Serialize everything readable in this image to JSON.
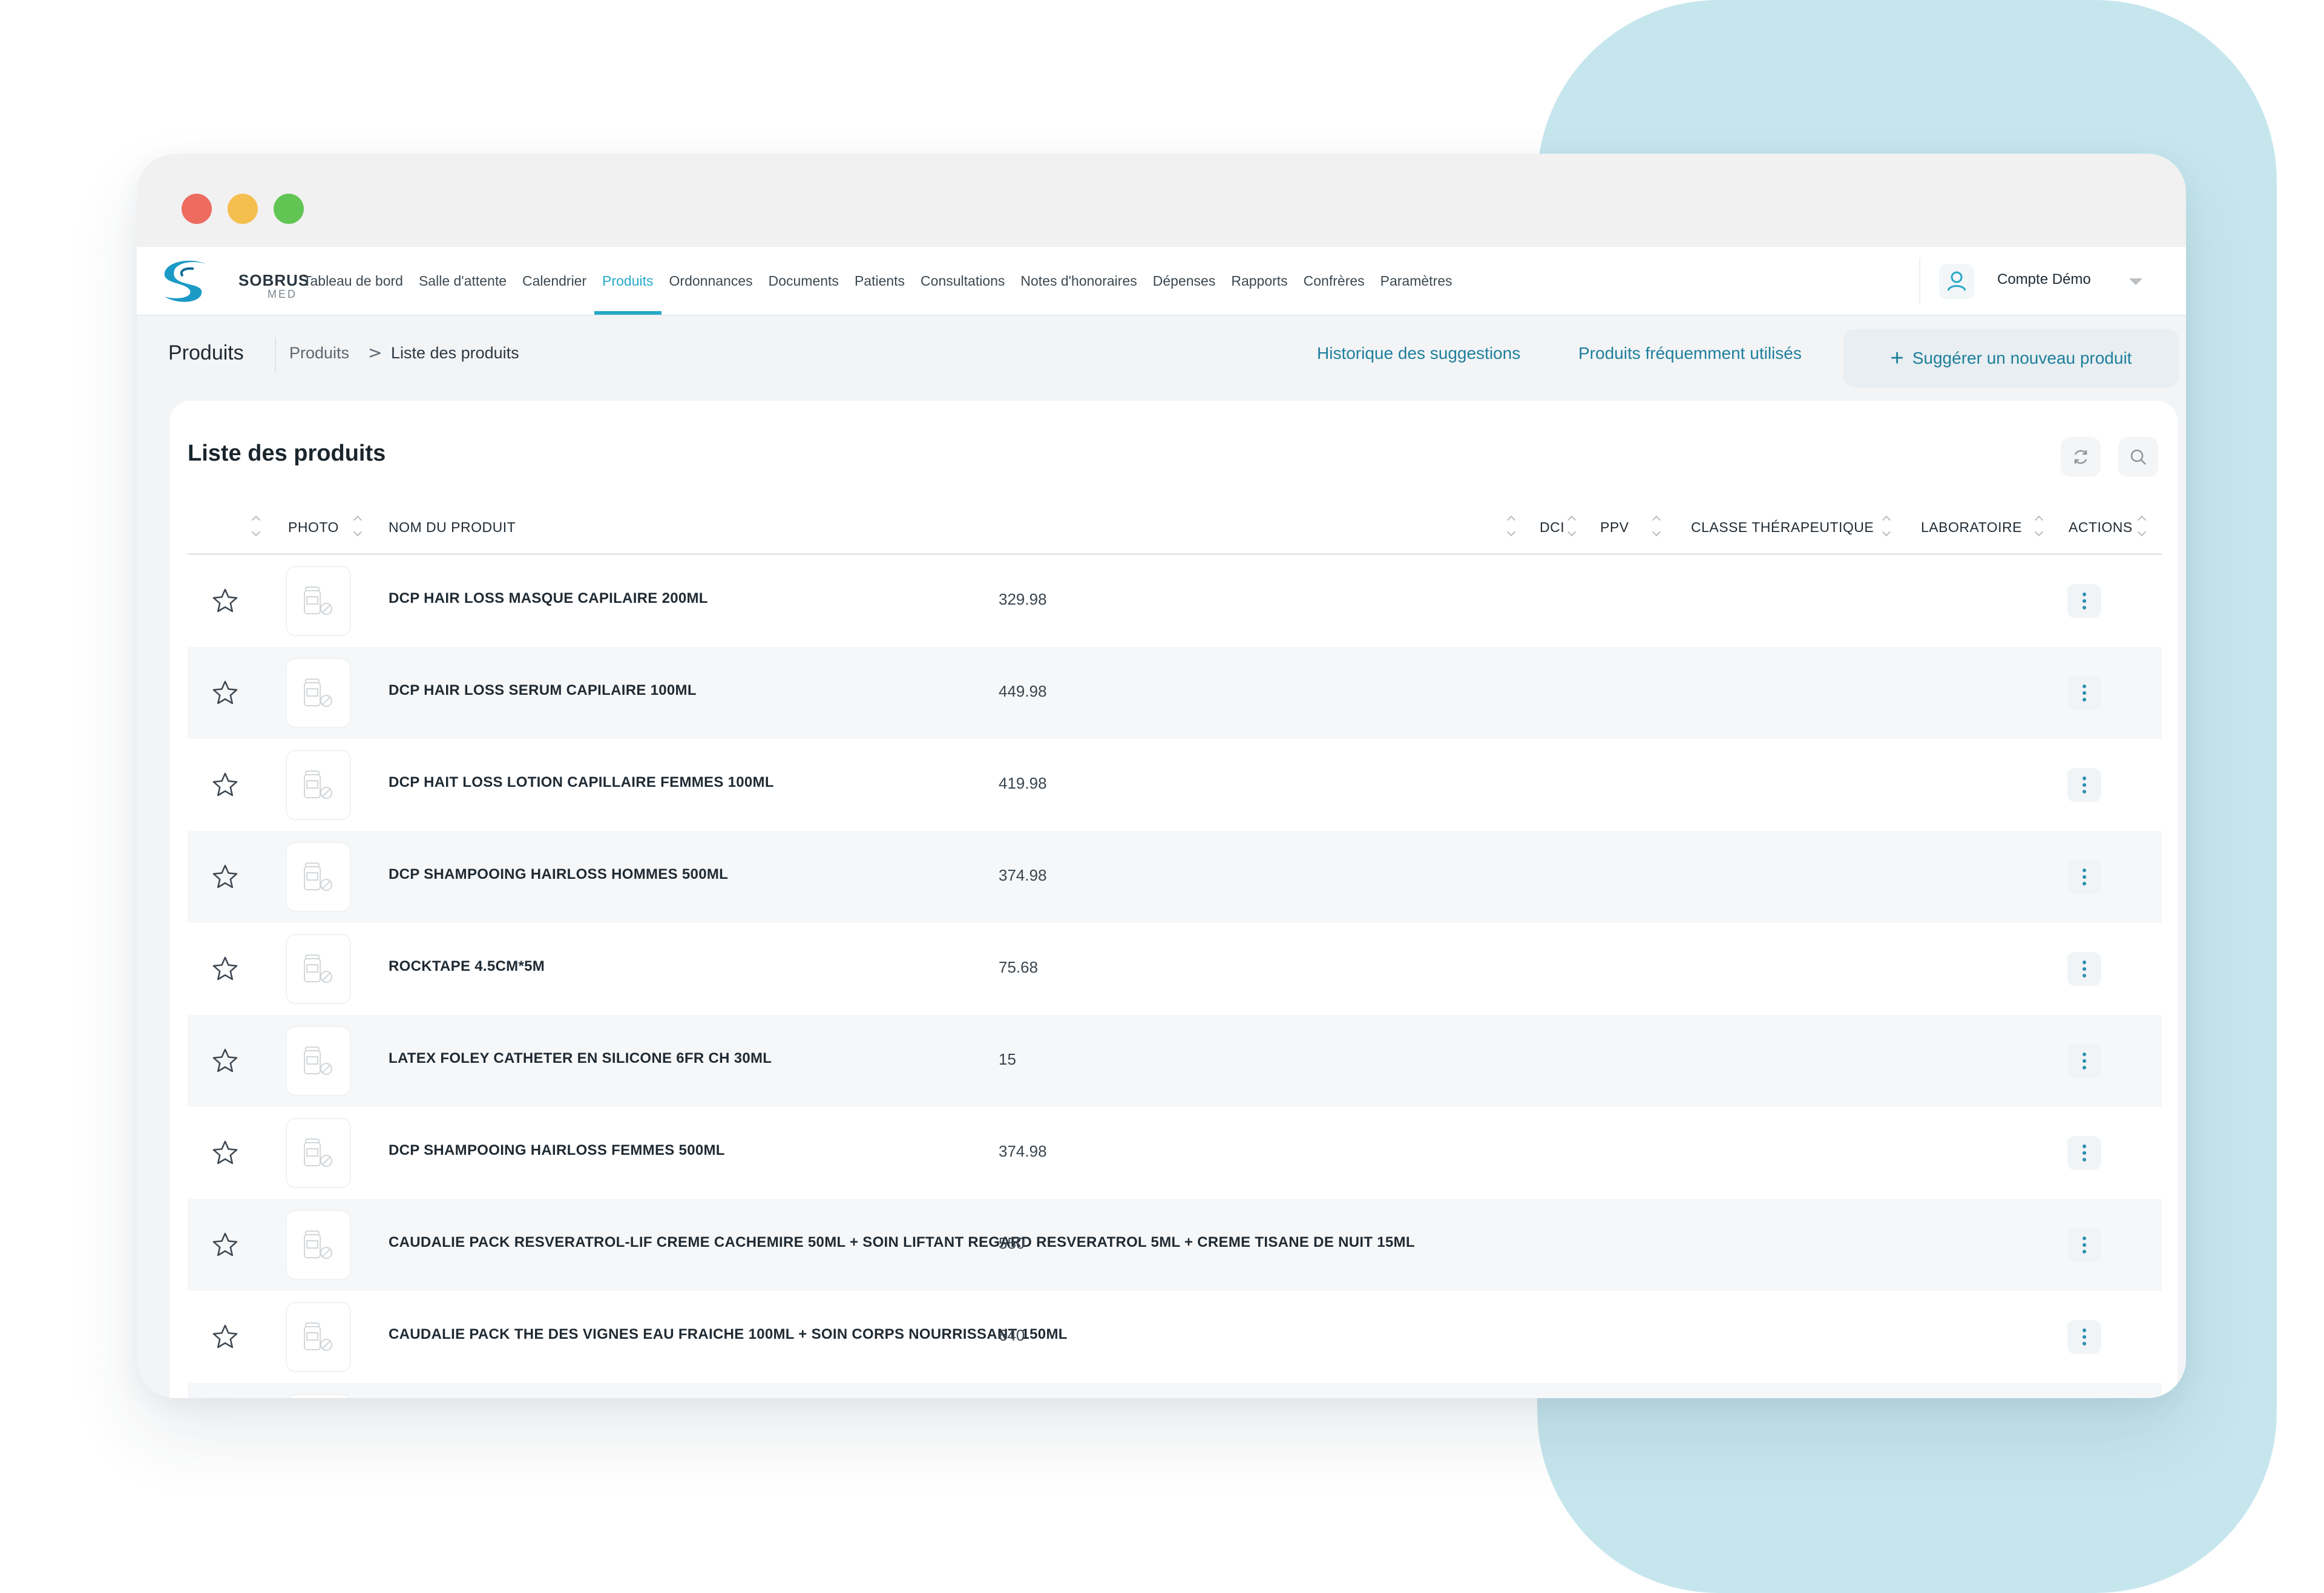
{
  "colors": {
    "accent": "#27a9c8",
    "link": "#1e7f9c",
    "background_blob": "#c6e6ee",
    "traffic_red": "#ee6b60",
    "traffic_yellow": "#f5bf4f",
    "traffic_green": "#61c554"
  },
  "brand": {
    "name": "SOBRUS",
    "sub": "MED"
  },
  "nav": {
    "items": [
      {
        "label": "Tableau de bord",
        "active": false
      },
      {
        "label": "Salle d'attente",
        "active": false
      },
      {
        "label": "Calendrier",
        "active": false
      },
      {
        "label": "Produits",
        "active": true
      },
      {
        "label": "Ordonnances",
        "active": false
      },
      {
        "label": "Documents",
        "active": false
      },
      {
        "label": "Patients",
        "active": false
      },
      {
        "label": "Consultations",
        "active": false
      },
      {
        "label": "Notes d'honoraires",
        "active": false
      },
      {
        "label": "Dépenses",
        "active": false
      },
      {
        "label": "Rapports",
        "active": false
      },
      {
        "label": "Confrères",
        "active": false
      },
      {
        "label": "Paramètres",
        "active": false
      }
    ],
    "account": {
      "name": "Compte Démo",
      "icon": "user-icon"
    }
  },
  "breadcrumb": {
    "page_title": "Produits",
    "level1": "Produits",
    "separator": ">",
    "level2": "Liste des produits"
  },
  "actions": {
    "history_link": "Historique des suggestions",
    "frequent_link": "Produits fréquemment utilisés",
    "suggest_button": "Suggérer un nouveau produit"
  },
  "card": {
    "title": "Liste des produits",
    "tools": [
      "refresh-icon",
      "search-icon"
    ]
  },
  "table": {
    "columns": {
      "photo": "PHOTO",
      "name": "NOM DU PRODUIT",
      "dci": "DCI",
      "ppv": "PPV",
      "classe": "CLASSE THÉRAPEUTIQUE",
      "laboratoire": "LABORATOIRE",
      "actions": "ACTIONS"
    },
    "rows": [
      {
        "name": "DCP HAIR LOSS MASQUE CAPILAIRE 200ML",
        "ppv": "329.98"
      },
      {
        "name": "DCP HAIR LOSS SERUM CAPILAIRE 100ML",
        "ppv": "449.98"
      },
      {
        "name": "DCP HAIT LOSS LOTION CAPILLAIRE FEMMES 100ML",
        "ppv": "419.98"
      },
      {
        "name": "DCP SHAMPOOING HAIRLOSS HOMMES 500ML",
        "ppv": "374.98"
      },
      {
        "name": "ROCKTAPE 4.5CM*5M",
        "ppv": "75.68"
      },
      {
        "name": "LATEX FOLEY CATHETER EN SILICONE 6FR CH 30ML",
        "ppv": "15"
      },
      {
        "name": "DCP SHAMPOOING HAIRLOSS FEMMES 500ML",
        "ppv": "374.98"
      },
      {
        "name": "CAUDALIE PACK RESVERATROL-LIF CREME CACHEMIRE 50ML + SOIN LIFTANT REGARD RESVERATROL 5ML + CREME TISANE DE NUIT 15ML",
        "ppv": "550"
      },
      {
        "name": "CAUDALIE PACK THE DES VIGNES EAU FRAICHE 100ML + SOIN CORPS NOURRISSANT 150ML",
        "ppv": "640"
      }
    ]
  }
}
